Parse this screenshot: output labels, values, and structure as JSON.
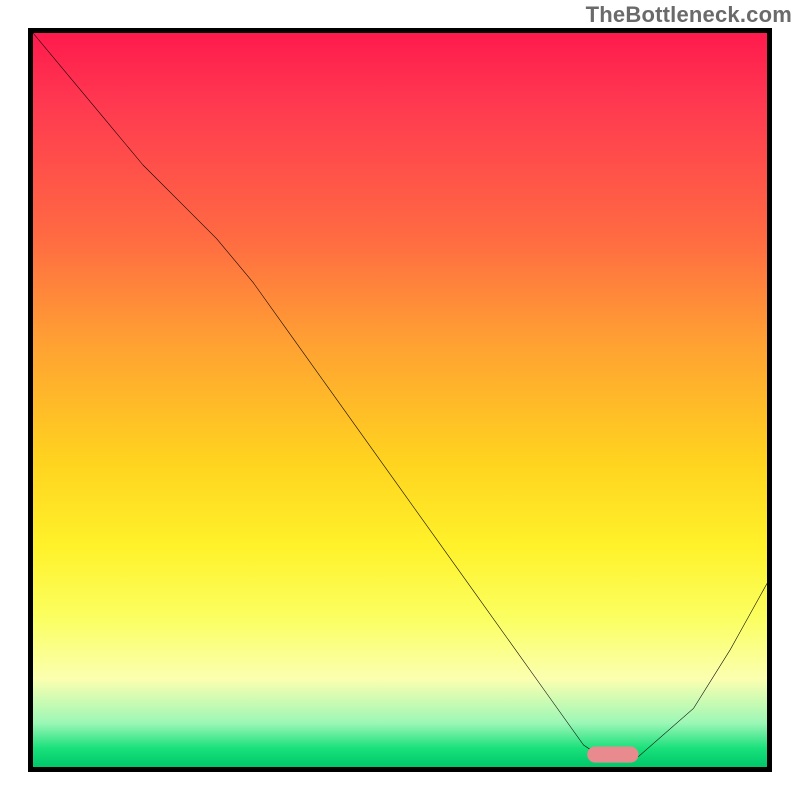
{
  "watermark": "TheBottleneck.com",
  "chart_data": {
    "type": "line",
    "title": "",
    "xlabel": "",
    "ylabel": "",
    "xlim": [
      0,
      100
    ],
    "ylim": [
      0,
      100
    ],
    "series": [
      {
        "name": "curve",
        "x": [
          0,
          5,
          10,
          15,
          20,
          25,
          30,
          35,
          40,
          45,
          50,
          55,
          60,
          65,
          70,
          75,
          78,
          82,
          90,
          95,
          100
        ],
        "y": [
          100,
          94,
          88,
          82,
          77,
          72,
          66,
          59,
          52,
          45,
          38,
          31,
          24,
          17,
          10,
          3,
          1,
          1,
          8,
          16,
          25
        ]
      }
    ],
    "marker": {
      "x": 79,
      "width": 7,
      "color": "#e98a8e"
    },
    "gradient_stops": [
      {
        "pos": 0.0,
        "color": "#ff1a4d"
      },
      {
        "pos": 0.1,
        "color": "#ff3a50"
      },
      {
        "pos": 0.28,
        "color": "#ff6b42"
      },
      {
        "pos": 0.42,
        "color": "#ffa033"
      },
      {
        "pos": 0.58,
        "color": "#ffd21f"
      },
      {
        "pos": 0.7,
        "color": "#fff22a"
      },
      {
        "pos": 0.8,
        "color": "#fbff63"
      },
      {
        "pos": 0.88,
        "color": "#fbffb0"
      },
      {
        "pos": 0.94,
        "color": "#9cf7b6"
      },
      {
        "pos": 0.975,
        "color": "#18e07a"
      },
      {
        "pos": 1.0,
        "color": "#00c86a"
      }
    ]
  }
}
